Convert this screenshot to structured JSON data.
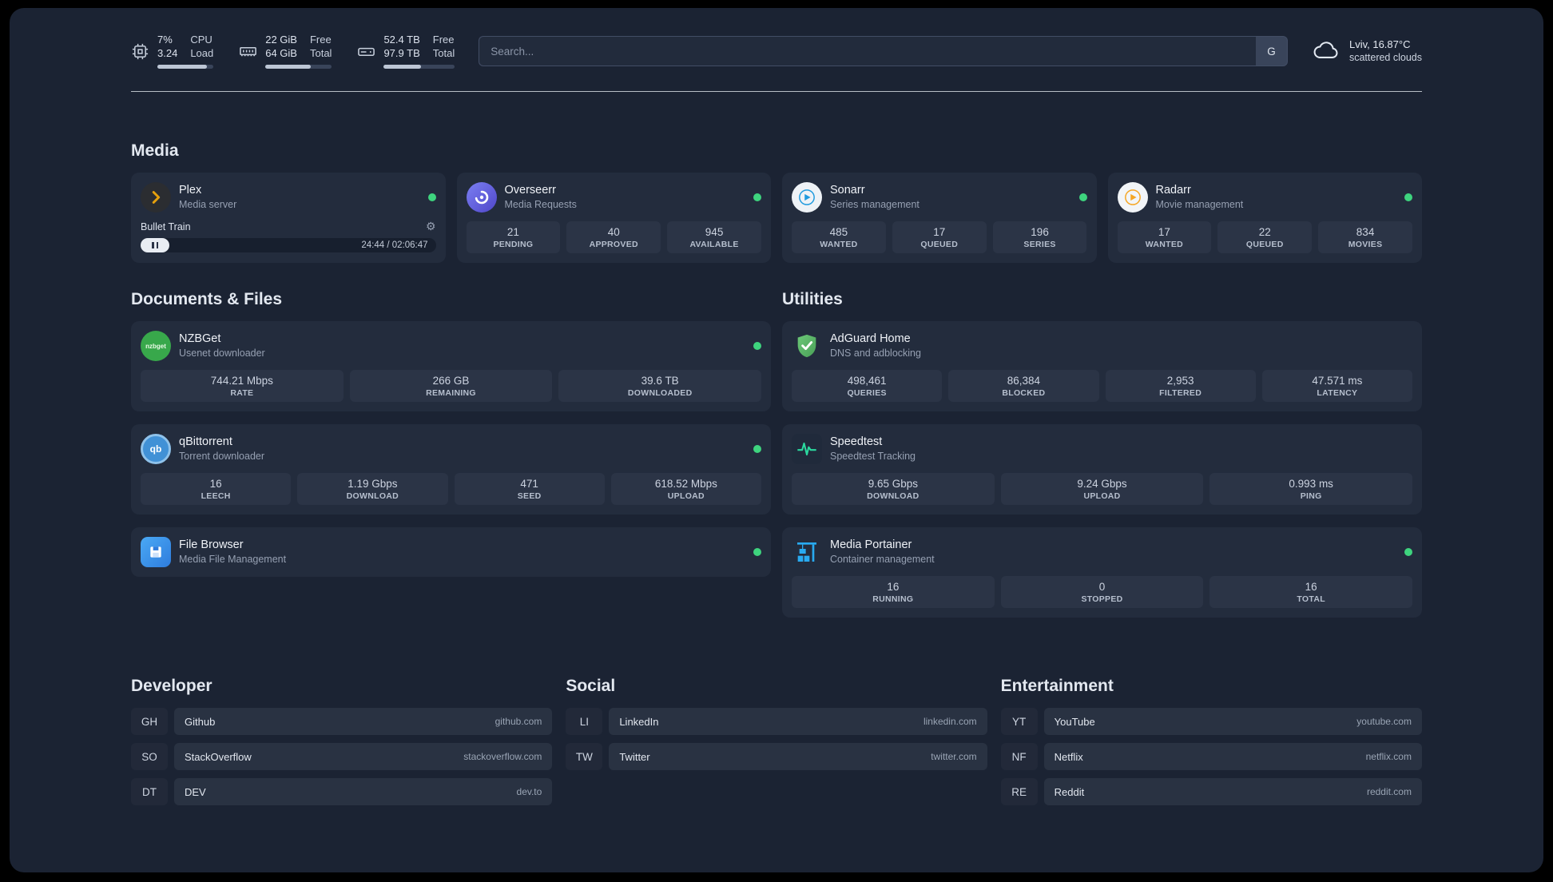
{
  "topbar": {
    "cpu": {
      "value1": "7%",
      "value2": "3.24",
      "label1": "CPU",
      "label2": "Load"
    },
    "memory": {
      "value1": "22 GiB",
      "value2": "64 GiB",
      "label1": "Free",
      "label2": "Total"
    },
    "disk": {
      "value1": "52.4 TB",
      "value2": "97.9 TB",
      "label1": "Free",
      "label2": "Total"
    },
    "search": {
      "placeholder": "Search...",
      "button": "G"
    },
    "weather": {
      "location": "Lviv, 16.87°C",
      "condition": "scattered clouds"
    }
  },
  "media": {
    "title": "Media",
    "cards": [
      {
        "name": "Plex",
        "desc": "Media server",
        "status": "online",
        "player": {
          "track": "Bullet Train",
          "time": "24:44 / 02:06:47"
        }
      },
      {
        "name": "Overseerr",
        "desc": "Media Requests",
        "status": "online",
        "stats": [
          {
            "value": "21",
            "label": "PENDING"
          },
          {
            "value": "40",
            "label": "APPROVED"
          },
          {
            "value": "945",
            "label": "AVAILABLE"
          }
        ]
      },
      {
        "name": "Sonarr",
        "desc": "Series management",
        "status": "online",
        "stats": [
          {
            "value": "485",
            "label": "WANTED"
          },
          {
            "value": "17",
            "label": "QUEUED"
          },
          {
            "value": "196",
            "label": "SERIES"
          }
        ]
      },
      {
        "name": "Radarr",
        "desc": "Movie management",
        "status": "online",
        "stats": [
          {
            "value": "17",
            "label": "WANTED"
          },
          {
            "value": "22",
            "label": "QUEUED"
          },
          {
            "value": "834",
            "label": "MOVIES"
          }
        ]
      }
    ]
  },
  "documents": {
    "title": "Documents & Files",
    "cards": [
      {
        "name": "NZBGet",
        "desc": "Usenet downloader",
        "status": "online",
        "stats": [
          {
            "value": "744.21 Mbps",
            "label": "RATE"
          },
          {
            "value": "266 GB",
            "label": "REMAINING"
          },
          {
            "value": "39.6 TB",
            "label": "DOWNLOADED"
          }
        ]
      },
      {
        "name": "qBittorrent",
        "desc": "Torrent downloader",
        "status": "online",
        "stats": [
          {
            "value": "16",
            "label": "LEECH"
          },
          {
            "value": "1.19 Gbps",
            "label": "DOWNLOAD"
          },
          {
            "value": "471",
            "label": "SEED"
          },
          {
            "value": "618.52 Mbps",
            "label": "UPLOAD"
          }
        ]
      },
      {
        "name": "File Browser",
        "desc": "Media File Management",
        "status": "online"
      }
    ]
  },
  "utilities": {
    "title": "Utilities",
    "cards": [
      {
        "name": "AdGuard Home",
        "desc": "DNS and adblocking",
        "stats": [
          {
            "value": "498,461",
            "label": "QUERIES"
          },
          {
            "value": "86,384",
            "label": "BLOCKED"
          },
          {
            "value": "2,953",
            "label": "FILTERED"
          },
          {
            "value": "47.571 ms",
            "label": "LATENCY"
          }
        ]
      },
      {
        "name": "Speedtest",
        "desc": "Speedtest Tracking",
        "stats": [
          {
            "value": "9.65 Gbps",
            "label": "DOWNLOAD"
          },
          {
            "value": "9.24 Gbps",
            "label": "UPLOAD"
          },
          {
            "value": "0.993 ms",
            "label": "PING"
          }
        ]
      },
      {
        "name": "Media Portainer",
        "desc": "Container management",
        "status": "online",
        "stats": [
          {
            "value": "16",
            "label": "RUNNING"
          },
          {
            "value": "0",
            "label": "STOPPED"
          },
          {
            "value": "16",
            "label": "TOTAL"
          }
        ]
      }
    ]
  },
  "bookmarks": [
    {
      "title": "Developer",
      "items": [
        {
          "abbr": "GH",
          "name": "Github",
          "url": "github.com"
        },
        {
          "abbr": "SO",
          "name": "StackOverflow",
          "url": "stackoverflow.com"
        },
        {
          "abbr": "DT",
          "name": "DEV",
          "url": "dev.to"
        }
      ]
    },
    {
      "title": "Social",
      "items": [
        {
          "abbr": "LI",
          "name": "LinkedIn",
          "url": "linkedin.com"
        },
        {
          "abbr": "TW",
          "name": "Twitter",
          "url": "twitter.com"
        }
      ]
    },
    {
      "title": "Entertainment",
      "items": [
        {
          "abbr": "YT",
          "name": "YouTube",
          "url": "youtube.com"
        },
        {
          "abbr": "NF",
          "name": "Netflix",
          "url": "netflix.com"
        },
        {
          "abbr": "RE",
          "name": "Reddit",
          "url": "reddit.com"
        }
      ]
    }
  ],
  "icons": {
    "nzbget_logo": "nzbget",
    "qbittorrent_logo": "qb",
    "pause_glyph": "pause",
    "gear_glyph": "⚙"
  },
  "colors": {
    "status_online": "#3ed47e",
    "background": "#1b2333",
    "card": "#232c3d",
    "plex_gold": "#e5a00d",
    "speedtest_green": "#2bd99f"
  }
}
